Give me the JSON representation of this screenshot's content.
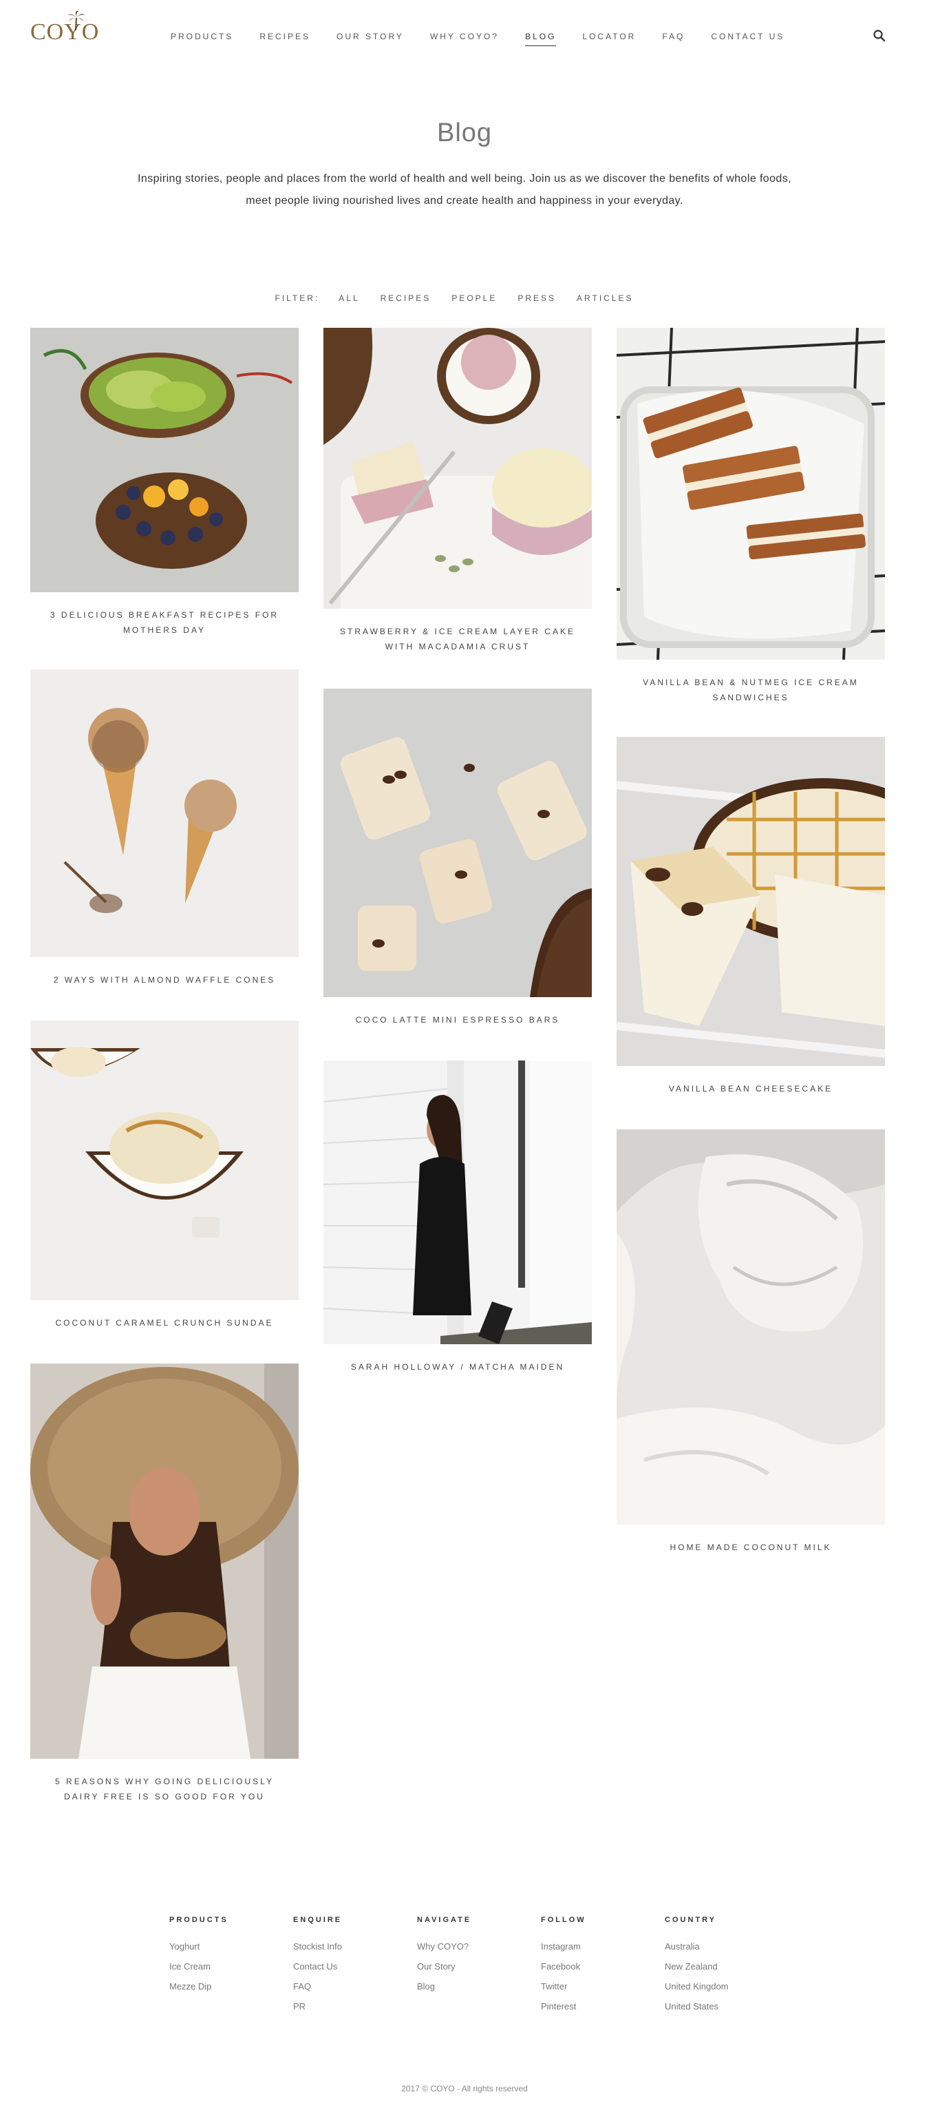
{
  "brand": {
    "name": "COYO"
  },
  "nav": {
    "items": [
      "PRODUCTS",
      "RECIPES",
      "OUR STORY",
      "WHY COYO?",
      "BLOG",
      "LOCATOR",
      "FAQ",
      "CONTACT US"
    ],
    "active": "BLOG"
  },
  "page": {
    "title": "Blog",
    "intro": "Inspiring stories, people and places from the world of health and well being. Join us as we discover the benefits of whole foods, meet people living nourished lives and create health and happiness in your everyday."
  },
  "filter": {
    "label": "FILTER:",
    "options": [
      "ALL",
      "RECIPES",
      "PEOPLE",
      "PRESS",
      "ARTICLES"
    ]
  },
  "posts": [
    {
      "title": "3 DELICIOUS BREAKFAST RECIPES FOR MOTHERS DAY",
      "image": "toast-breakfast-image"
    },
    {
      "title": "STRAWBERRY & ICE CREAM LAYER CAKE WITH MACADAMIA CRUST",
      "image": "layer-cake-image"
    },
    {
      "title": "VANILLA BEAN & NUTMEG ICE CREAM SANDWICHES",
      "image": "ice-cream-sandwich-image"
    },
    {
      "title": "2 WAYS WITH ALMOND WAFFLE CONES",
      "image": "waffle-cone-image"
    },
    {
      "title": "COCO LATTE MINI ESPRESSO BARS",
      "image": "espresso-bars-image"
    },
    {
      "title": "VANILLA BEAN CHEESECAKE",
      "image": "cheesecake-image"
    },
    {
      "title": "COCONUT CARAMEL CRUNCH SUNDAE",
      "image": "coconut-sundae-image"
    },
    {
      "title": "SARAH HOLLOWAY / MATCHA MAIDEN",
      "image": "woman-black-dress-image"
    },
    {
      "title": "HOME MADE COCONUT MILK",
      "image": "coconut-milk-image"
    },
    {
      "title": "5 REASONS WHY GOING DELICIOUSLY DAIRY FREE IS SO GOOD FOR YOU",
      "image": "woman-straw-hat-image"
    }
  ],
  "footer": {
    "columns": [
      {
        "heading": "PRODUCTS",
        "links": [
          "Yoghurt",
          "Ice Cream",
          "Mezze Dip"
        ]
      },
      {
        "heading": "ENQUIRE",
        "links": [
          "Stockist Info",
          "Contact Us",
          "FAQ",
          "PR"
        ]
      },
      {
        "heading": "NAVIGATE",
        "links": [
          "Why COYO?",
          "Our Story",
          "Blog"
        ]
      },
      {
        "heading": "FOLLOW",
        "links": [
          "Instagram",
          "Facebook",
          "Twitter",
          "Pinterest"
        ]
      },
      {
        "heading": "COUNTRY",
        "links": [
          "Australia",
          "New Zealand",
          "United Kingdom",
          "United States"
        ]
      }
    ],
    "copyright": "2017 © COYO - All rights reserved"
  },
  "colors": {
    "brand": "#8a6a3a",
    "text": "#333333",
    "muted": "#777777"
  }
}
